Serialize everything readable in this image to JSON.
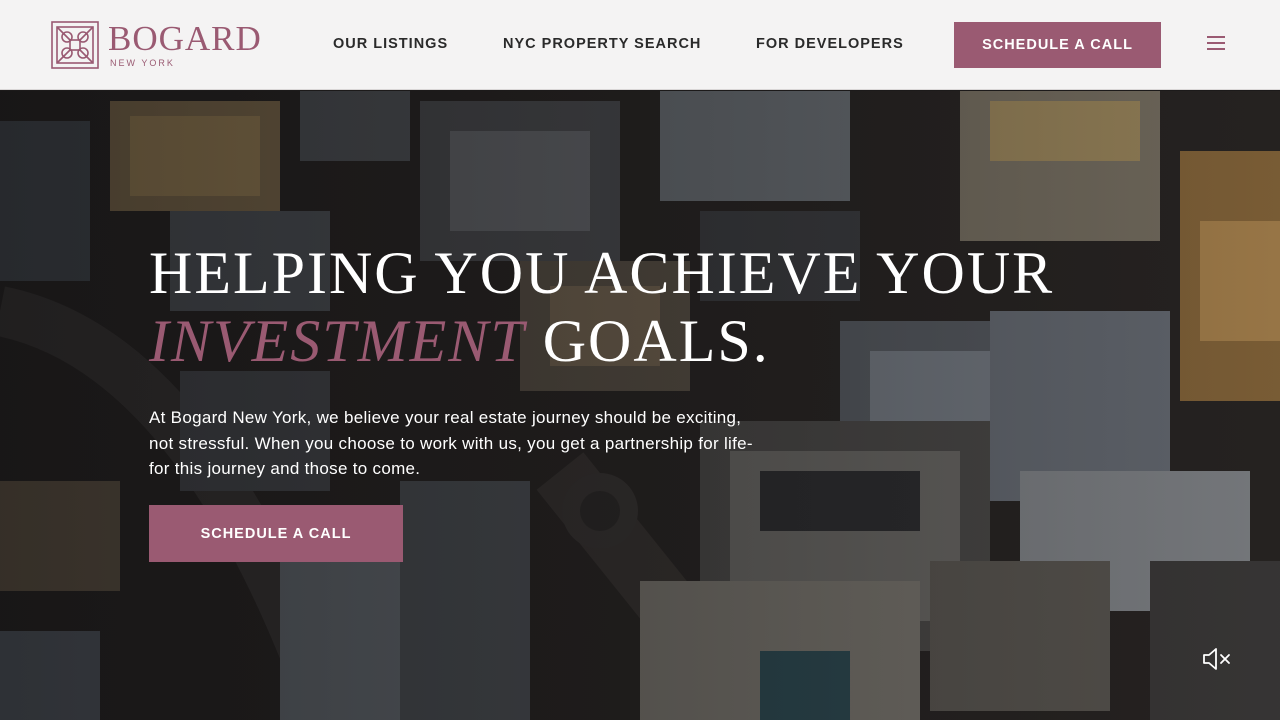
{
  "brand": {
    "name": "BOGARD",
    "subtitle": "NEW YORK",
    "color": "#9a5a72"
  },
  "nav": {
    "items": [
      {
        "label": "OUR LISTINGS"
      },
      {
        "label": "NYC PROPERTY SEARCH"
      },
      {
        "label": "FOR DEVELOPERS"
      }
    ],
    "cta_label": "SCHEDULE A CALL",
    "menu_icon": "hamburger-menu-icon"
  },
  "hero": {
    "title_line1": "HELPING YOU ACHIEVE YOUR",
    "title_accent": "INVESTMENT",
    "title_rest": " GOALS.",
    "body": "At Bogard New York, we believe your real estate journey should be exciting, not stressful. When you choose to work with us, you get a partnership for life-for this journey and those to come.",
    "cta_label": "SCHEDULE A CALL",
    "mute_icon": "speaker-muted-icon"
  },
  "colors": {
    "accent": "#9a5a72",
    "header_bg": "#f4f3f3",
    "text_dark": "#2a2a2a"
  }
}
